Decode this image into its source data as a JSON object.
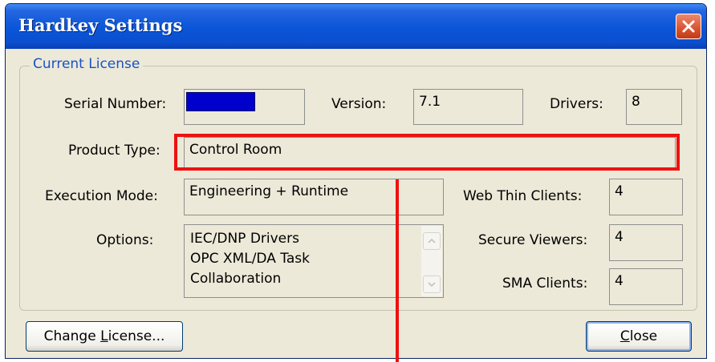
{
  "window": {
    "title": "Hardkey Settings"
  },
  "group": {
    "label": "Current License"
  },
  "fields": {
    "serial_number": {
      "label": "Serial Number:",
      "value": ""
    },
    "version": {
      "label": "Version:",
      "value": "7.1"
    },
    "drivers": {
      "label": "Drivers:",
      "value": "8"
    },
    "product_type": {
      "label": "Product Type:",
      "value": "Control Room"
    },
    "execution_mode": {
      "label": "Execution Mode:",
      "value": "Engineering + Runtime"
    },
    "web_thin_clients": {
      "label": "Web Thin Clients:",
      "value": "4"
    },
    "options": {
      "label": "Options:",
      "items": [
        "IEC/DNP Drivers",
        "OPC XML/DA Task",
        "Collaboration"
      ]
    },
    "secure_viewers": {
      "label": "Secure Viewers:",
      "value": "4"
    },
    "sma_clients": {
      "label": "SMA Clients:",
      "value": "4"
    }
  },
  "buttons": {
    "change_license": {
      "pre": "Change ",
      "mnemonic": "L",
      "post": "icense..."
    },
    "close": {
      "pre": "",
      "mnemonic": "C",
      "post": "lose"
    }
  },
  "icons": {
    "close": "close-icon",
    "scroll_up": "scroll-up-icon",
    "scroll_down": "scroll-down-icon"
  },
  "colors": {
    "title_bar": "#0a55d8",
    "group_label": "#1c51c4",
    "highlight": "#ee1111",
    "serial_mask": "#0000cc"
  }
}
